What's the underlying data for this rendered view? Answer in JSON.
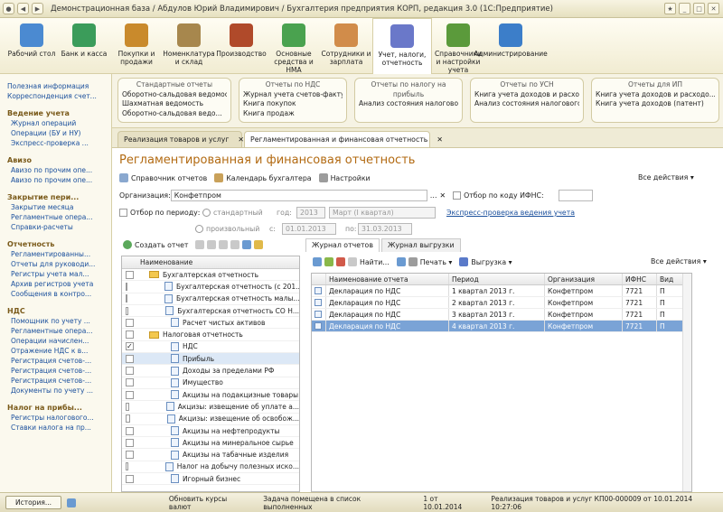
{
  "title": "Демонстрационная база / Абдулов Юрий Владимирович / Бухгалтерия предприятия КОРП, редакция 3.0  (1С:Предприятие)",
  "sections": [
    {
      "label": "Рабочий стол",
      "color": "#4b8ad1"
    },
    {
      "label": "Банк и касса",
      "color": "#3b9c5a"
    },
    {
      "label": "Покупки и продажи",
      "color": "#c98a2c"
    },
    {
      "label": "Номенклатура и склад",
      "color": "#a7874d"
    },
    {
      "label": "Производство",
      "color": "#b04a2a"
    },
    {
      "label": "Основные средства и НМА",
      "color": "#4aa24f"
    },
    {
      "label": "Сотрудники и зарплата",
      "color": "#d18c4a"
    },
    {
      "label": "Учет, налоги, отчетность",
      "color": "#6a78c9"
    },
    {
      "label": "Справочники и настройки учета",
      "color": "#5b9a3b"
    },
    {
      "label": "Администрирование",
      "color": "#3c7ec9"
    }
  ],
  "groups": [
    {
      "title": "Стандартные отчеты",
      "items": [
        "Оборотно-сальдовая ведомость",
        "Шахматная ведомость",
        "Оборотно-сальдовая ведо..."
      ]
    },
    {
      "title": "Отчеты по НДС",
      "items": [
        "Журнал учета счетов-фактур",
        "Книга покупок",
        "Книга продаж"
      ]
    },
    {
      "title": "Отчеты по налогу на прибыль",
      "items": [
        "Анализ состояния налогового ..."
      ]
    },
    {
      "title": "Отчеты по УСН",
      "items": [
        "Книга учета доходов и расход...",
        "Анализ состояния налогового ..."
      ]
    },
    {
      "title": "Отчеты для ИП",
      "items": [
        "Книга учета доходов и расходо...",
        "Книга учета доходов (патент)"
      ]
    }
  ],
  "left": [
    {
      "t": "l0",
      "v": "Полезная информация"
    },
    {
      "t": "l0",
      "v": "Корреспонденция счет..."
    },
    {
      "t": "h",
      "v": "Ведение учета"
    },
    {
      "t": "l",
      "v": "Журнал операций"
    },
    {
      "t": "l",
      "v": "Операции (БУ и НУ)"
    },
    {
      "t": "l",
      "v": "Экспресс-проверка ..."
    },
    {
      "t": "h",
      "v": "Авизо"
    },
    {
      "t": "l",
      "v": "Авизо по прочим опе..."
    },
    {
      "t": "l",
      "v": "Авизо по прочим опе..."
    },
    {
      "t": "h",
      "v": "Закрытие пери..."
    },
    {
      "t": "l",
      "v": "Закрытие месяца"
    },
    {
      "t": "l",
      "v": "Регламентные опера..."
    },
    {
      "t": "l",
      "v": "Справки-расчеты"
    },
    {
      "t": "h",
      "v": "Отчетность"
    },
    {
      "t": "l",
      "v": "Регламентированны..."
    },
    {
      "t": "l",
      "v": "Отчеты для руководи..."
    },
    {
      "t": "l",
      "v": "Регистры учета мал..."
    },
    {
      "t": "l",
      "v": "Архив регистров учета"
    },
    {
      "t": "l",
      "v": "Сообщения в контро..."
    },
    {
      "t": "h",
      "v": "НДС"
    },
    {
      "t": "l",
      "v": "Помощник по учету ..."
    },
    {
      "t": "l",
      "v": "Регламентные опера..."
    },
    {
      "t": "l",
      "v": "Операции начислен..."
    },
    {
      "t": "l",
      "v": "Отражение НДС к в..."
    },
    {
      "t": "l",
      "v": "Регистрация счетов-..."
    },
    {
      "t": "l",
      "v": "Регистрация счетов-..."
    },
    {
      "t": "l",
      "v": "Регистрация счетов-..."
    },
    {
      "t": "l",
      "v": "Документы по учету ..."
    },
    {
      "t": "h",
      "v": "Налог на прибы..."
    },
    {
      "t": "l",
      "v": "Регистры налогового..."
    },
    {
      "t": "l",
      "v": "Ставки налога на пр..."
    }
  ],
  "tabs": {
    "t1": "Реализация товаров и услуг",
    "t2": "Регламентированная и финансовая отчетность"
  },
  "form": {
    "title": "Регламентированная и финансовая отчетность",
    "btn_ref": "Справочник отчетов",
    "btn_cal": "Календарь бухгалтера",
    "btn_settings": "Настройки",
    "all_actions": "Все действия",
    "org_label": "Организация:",
    "org_value": "Конфетпром",
    "ifns_label": "Отбор по коду ИФНС:",
    "period_label": "Отбор по периоду:",
    "standard": "стандартный",
    "arbitrary": "произвольный",
    "year_label": "год:",
    "year": "2013",
    "period": "Март (I квартал)",
    "from_label": "с:",
    "from": "01.01.2013",
    "to_label": "по:",
    "to": "31.03.2013",
    "express": "Экспресс-проверка ведения учета",
    "create": "Создать отчет",
    "tree_header": "Наименование",
    "j_tab1": "Журнал отчетов",
    "j_tab2": "Журнал выгрузки",
    "find": "Найти...",
    "print": "Печать",
    "export": "Выгрузка"
  },
  "tree": [
    {
      "lvl": 0,
      "type": "folder",
      "text": "Бухгалтерская отчетность",
      "cb": false
    },
    {
      "lvl": 1,
      "type": "doc",
      "text": "Бухгалтерская отчетность (с 201...",
      "cb": false
    },
    {
      "lvl": 1,
      "type": "doc",
      "text": "Бухгалтерская отчетность малы...",
      "cb": false
    },
    {
      "lvl": 1,
      "type": "doc",
      "text": "Бухгалтерская отчетность СО Н...",
      "cb": false
    },
    {
      "lvl": 1,
      "type": "doc",
      "text": "Расчет чистых активов",
      "cb": false
    },
    {
      "lvl": 0,
      "type": "folder",
      "text": "Налоговая отчетность",
      "cb": false
    },
    {
      "lvl": 1,
      "type": "doc",
      "text": "НДС",
      "cb": true
    },
    {
      "lvl": 1,
      "type": "doc",
      "text": "Прибыль",
      "cb": false,
      "sel": true
    },
    {
      "lvl": 1,
      "type": "doc",
      "text": "Доходы за пределами РФ",
      "cb": false
    },
    {
      "lvl": 1,
      "type": "doc",
      "text": "Имущество",
      "cb": false
    },
    {
      "lvl": 1,
      "type": "doc",
      "text": "Акцизы на подакцизные товары",
      "cb": false
    },
    {
      "lvl": 1,
      "type": "doc",
      "text": "Акцизы: извещение об уплате а...",
      "cb": false
    },
    {
      "lvl": 1,
      "type": "doc",
      "text": "Акцизы: извещение об освобож...",
      "cb": false
    },
    {
      "lvl": 1,
      "type": "doc",
      "text": "Акцизы на нефтепродукты",
      "cb": false
    },
    {
      "lvl": 1,
      "type": "doc",
      "text": "Акцизы на минеральное сырье",
      "cb": false
    },
    {
      "lvl": 1,
      "type": "doc",
      "text": "Акцизы на табачные изделия",
      "cb": false
    },
    {
      "lvl": 1,
      "type": "doc",
      "text": "Налог на добычу полезных иско...",
      "cb": false
    },
    {
      "lvl": 1,
      "type": "doc",
      "text": "Игорный бизнес",
      "cb": false
    }
  ],
  "grid": {
    "headers": [
      "Наименование отчета",
      "Период",
      "Организация",
      "ИФНС",
      "Вид"
    ],
    "rows": [
      [
        "Декларация по НДС",
        "1 квартал 2013 г.",
        "Конфетпром",
        "7721",
        "П"
      ],
      [
        "Декларация по НДС",
        "2 квартал 2013 г.",
        "Конфетпром",
        "7721",
        "П"
      ],
      [
        "Декларация по НДС",
        "3 квартал 2013 г.",
        "Конфетпром",
        "7721",
        "П"
      ],
      [
        "Декларация по НДС",
        "4 квартал 2013 г.",
        "Конфетпром",
        "7721",
        "П"
      ]
    ],
    "selected": 3
  },
  "status": {
    "history": "История...",
    "s1": "Обновить курсы валют",
    "s2": "Задача помещена в список выполненных",
    "s3": "1 от 10.01.2014",
    "s4": "Реализация товаров и услуг КП00-000009 от 10.01.2014 10:27:06"
  }
}
